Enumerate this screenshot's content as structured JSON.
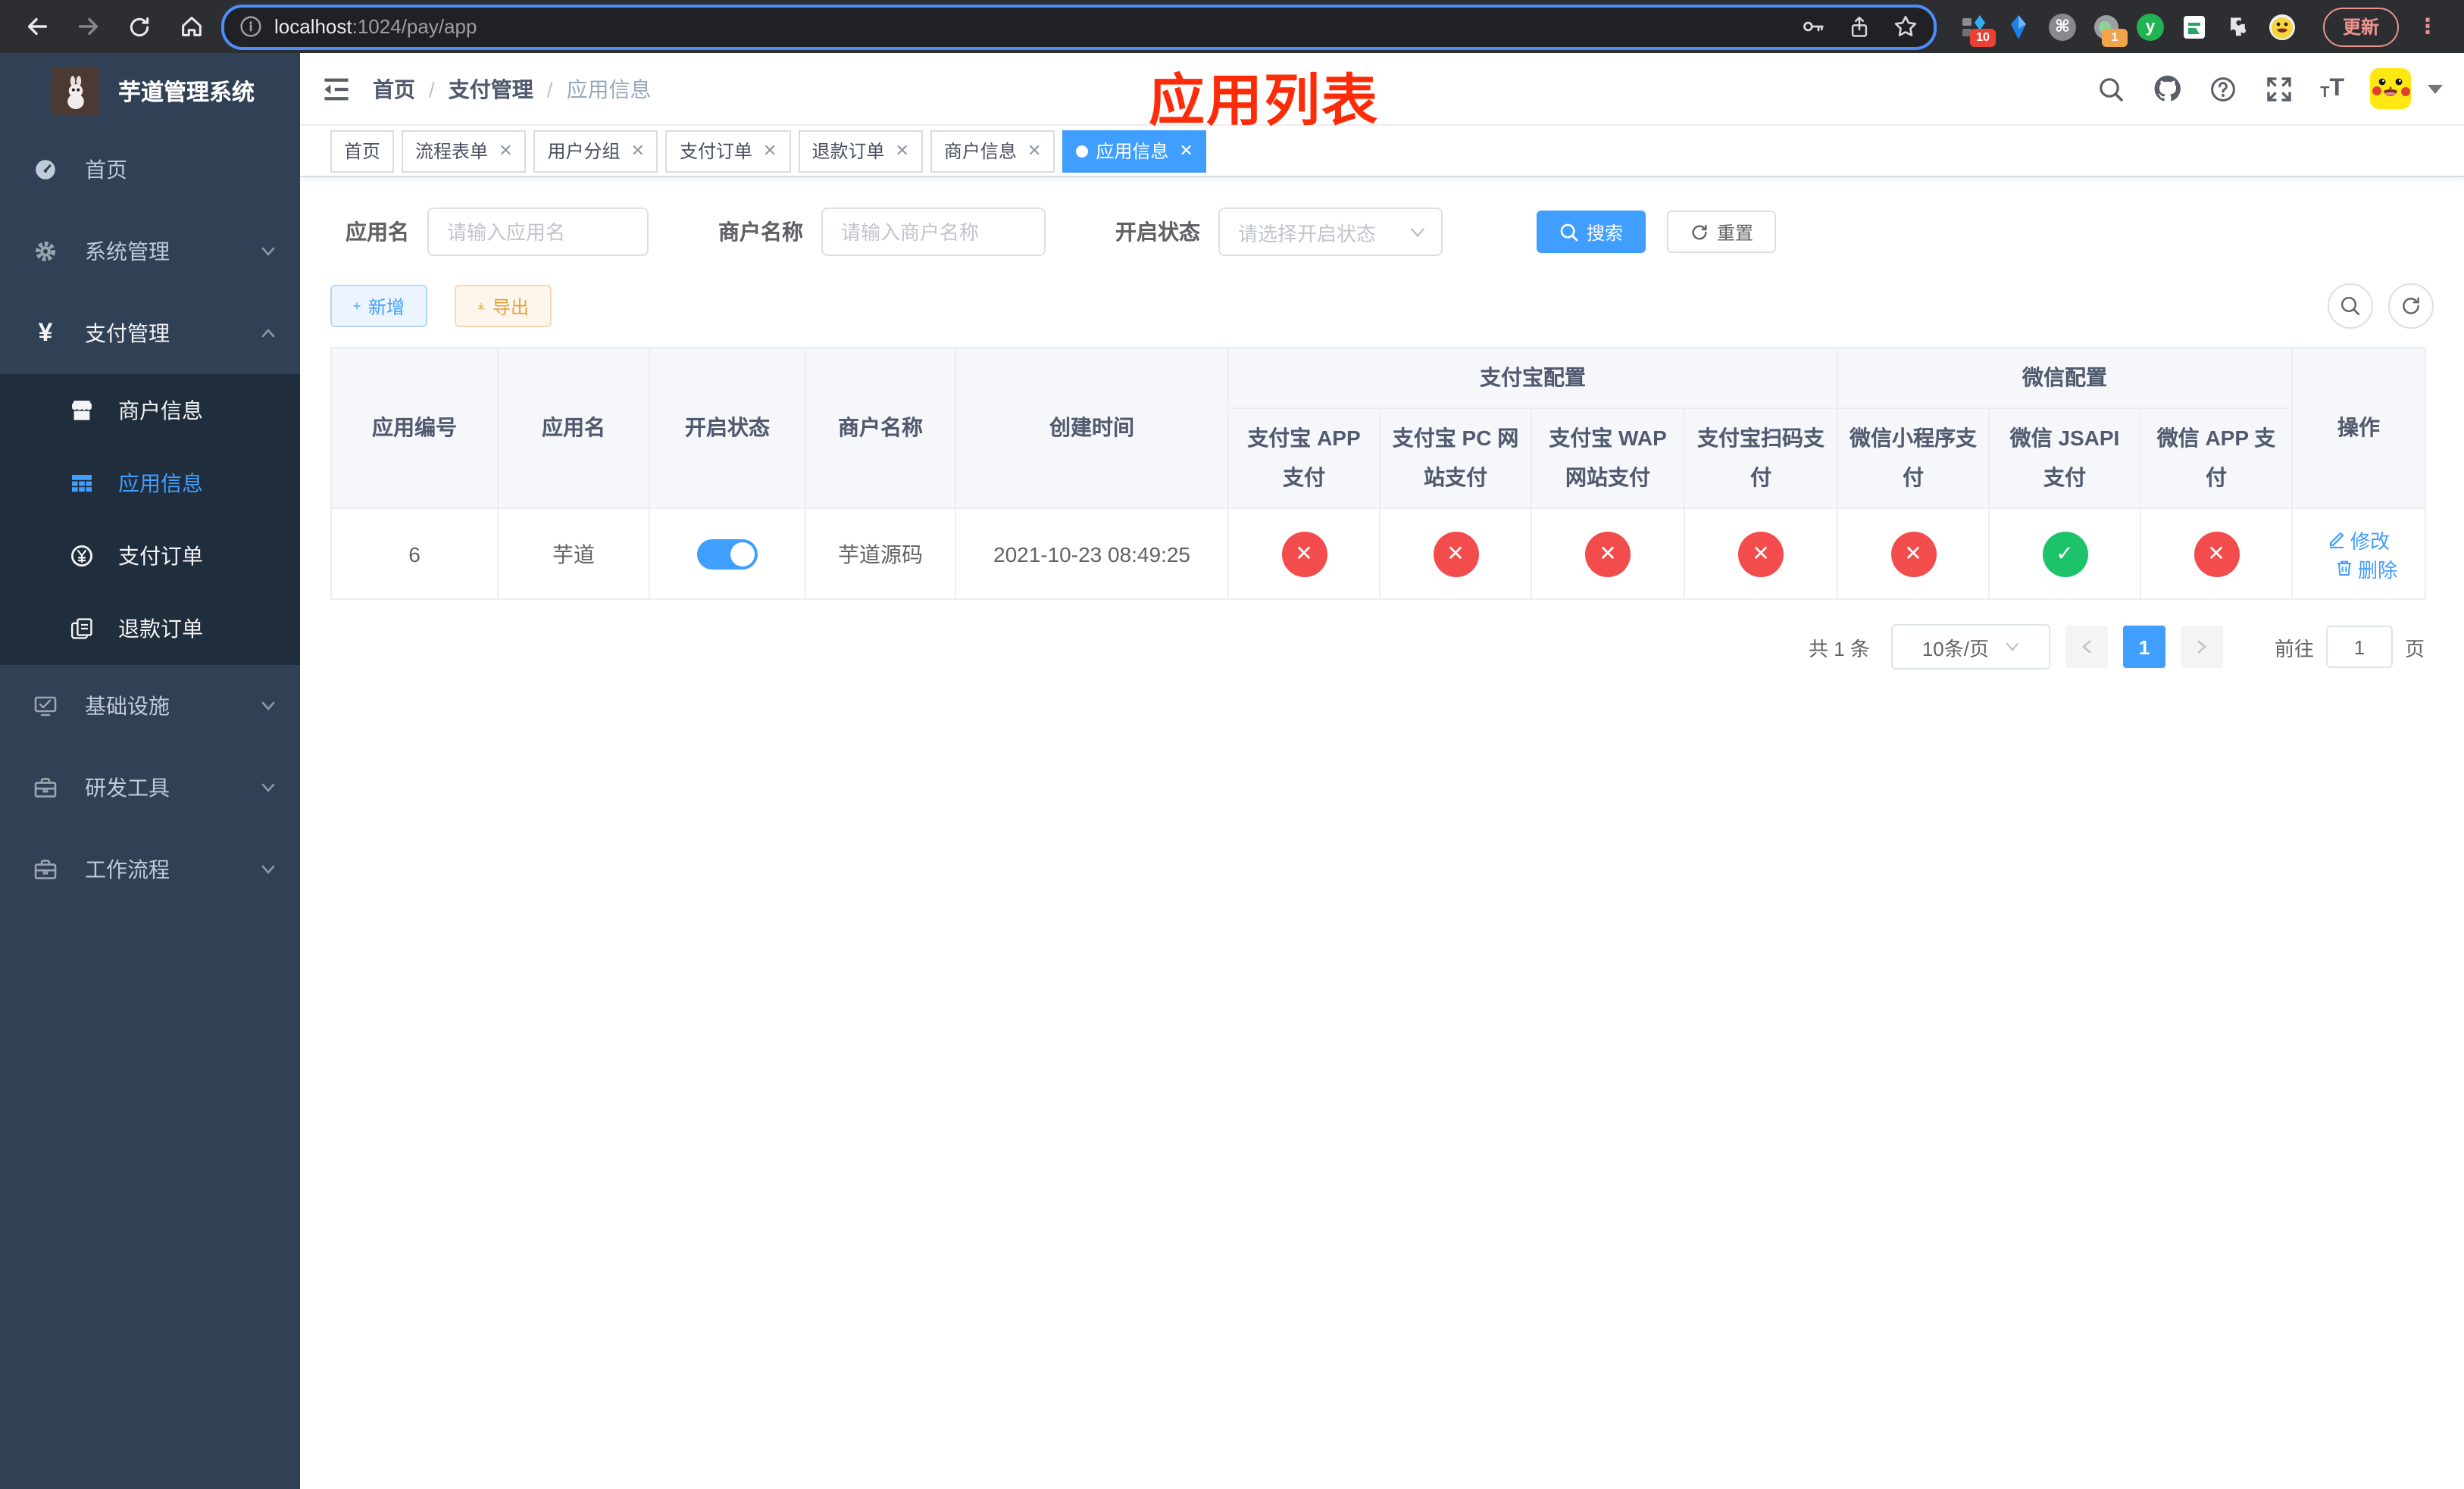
{
  "browser": {
    "url_host": "localhost",
    "url_rest": ":1024/pay/app",
    "update_label": "更新",
    "ext_badge_tabs": "10",
    "ext_badge_rec": "1",
    "ext_y_letter": "y"
  },
  "sidebar": {
    "title": "芋道管理系统",
    "menu": [
      {
        "label": "首页"
      },
      {
        "label": "系统管理"
      },
      {
        "label": "支付管理",
        "children": [
          {
            "label": "商户信息"
          },
          {
            "label": "应用信息"
          },
          {
            "label": "支付订单"
          },
          {
            "label": "退款订单"
          }
        ]
      },
      {
        "label": "基础设施"
      },
      {
        "label": "研发工具"
      },
      {
        "label": "工作流程"
      }
    ]
  },
  "header": {
    "breadcrumb": [
      "首页",
      "支付管理",
      "应用信息"
    ],
    "annotation": "应用列表"
  },
  "tabs": [
    {
      "label": "首页"
    },
    {
      "label": "流程表单"
    },
    {
      "label": "用户分组"
    },
    {
      "label": "支付订单"
    },
    {
      "label": "退款订单"
    },
    {
      "label": "商户信息"
    },
    {
      "label": "应用信息"
    }
  ],
  "filters": {
    "app_name_label": "应用名",
    "app_name_placeholder": "请输入应用名",
    "merchant_label": "商户名称",
    "merchant_placeholder": "请输入商户名称",
    "status_label": "开启状态",
    "status_placeholder": "请选择开启状态",
    "search_label": "搜索",
    "reset_label": "重置"
  },
  "toolbar": {
    "add_label": "新增",
    "export_label": "导出"
  },
  "table": {
    "columns": [
      "应用编号",
      "应用名",
      "开启状态",
      "商户名称",
      "创建时间"
    ],
    "groups": [
      "支付宝配置",
      "微信配置"
    ],
    "pay_columns": [
      "支付宝 APP 支付",
      "支付宝 PC 网站支付",
      "支付宝 WAP 网站支付",
      "支付宝扫码支付",
      "微信小程序支付",
      "微信 JSAPI 支付",
      "微信 APP 支付"
    ],
    "actions_header": "操作",
    "actions": [
      "修改",
      "删除"
    ],
    "rows": [
      {
        "id": "6",
        "name": "芋道",
        "enabled": true,
        "merchant": "芋道源码",
        "created": "2021-10-23 08:49:25",
        "statuses": [
          false,
          false,
          false,
          false,
          false,
          true,
          false
        ]
      }
    ]
  },
  "pagination": {
    "total": "共 1 条",
    "page_size": "10条/页",
    "page": "1",
    "goto_label": "前往",
    "goto_value": "1",
    "unit_label": "页"
  },
  "colors": {
    "accent": "#409eff",
    "success": "#1cc36a",
    "danger": "#f24c4c",
    "sidebar_bg": "#304156",
    "submenu_bg": "#1f2d3d",
    "annotation_red": "#fd2b07"
  }
}
